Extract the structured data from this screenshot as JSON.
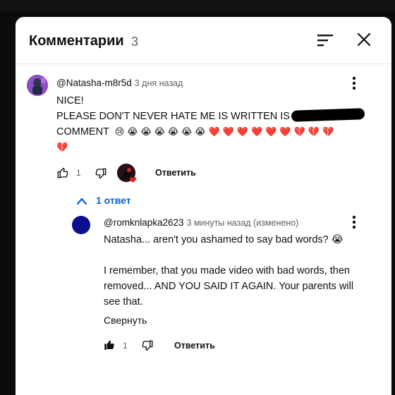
{
  "header": {
    "title": "Комментарии",
    "count": "3"
  },
  "comment": {
    "author": "@Natasha-m8r5d",
    "time": "3 дня назад",
    "line1": "NICE!",
    "line2": "PLEASE DON'T NEVER HATE ME IS WRITTEN IS",
    "line3_prefix": "COMMENT",
    "emoji_line3": [
      "😢",
      "😭",
      "😭",
      "😭",
      "😭",
      "😭",
      "😭",
      "❤️",
      "❤️",
      "❤️",
      "❤️",
      "❤️",
      "❤️",
      "💔",
      "💔",
      "💔"
    ],
    "emoji_line4": [
      "💔"
    ],
    "likes": "1",
    "reply_label": "Ответить"
  },
  "replies_toggle": {
    "label": "1 ответ"
  },
  "reply": {
    "author": "@romknlapka2623",
    "time": "3 минуты назад (изменено)",
    "line1": "Natasha... aren't you ashamed to say bad words? 😭",
    "line2": "I remember, that you made video with bad words, then",
    "line3": "removed... AND YOU SAID IT AGAIN. Your parents will",
    "line4": "see that.",
    "collapse_label": "Свернуть",
    "likes": "1",
    "reply_label": "Ответить"
  },
  "colors": {
    "link_blue": "#065fd4",
    "meta_gray": "#606060",
    "heart_red": "#e62117"
  },
  "icons": [
    "sort-icon",
    "close-icon",
    "kebab-icon",
    "thumb-up-icon",
    "thumb-down-icon",
    "chevron-up-icon",
    "heart-icon"
  ]
}
